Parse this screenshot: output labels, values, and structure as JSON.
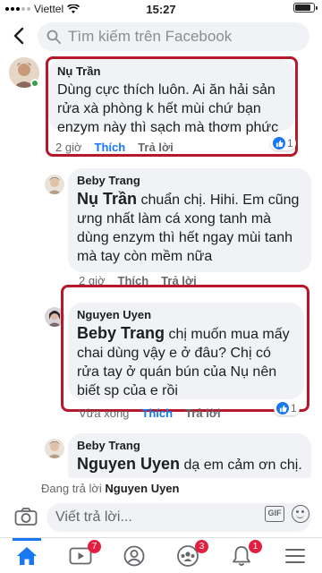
{
  "status_bar": {
    "carrier": "Viettel",
    "time": "15:27",
    "battery_level": 0.85
  },
  "search": {
    "placeholder": "Tìm kiếm trên Facebook"
  },
  "comments": [
    {
      "author": "Nụ Trần",
      "text": "Dùng cực thích luôn. Ai ăn hải sản rửa xà phòng k hết mùi chứ bạn enzym này thì sạch mà thơm phức",
      "time": "2 giờ",
      "like_label": "Thích",
      "reply_label": "Trả lời",
      "reactions": "1"
    },
    {
      "author": "Beby Trang",
      "mention": "Nụ Trần",
      "text": " chuẩn chị. Hihi. Em cũng ưng nhất làm cá xong tanh mà dùng enzym thì hết ngay mùi tanh mà tay còn mềm nữa",
      "time": "2 giờ",
      "like_label": "Thích",
      "reply_label": "Trả lời"
    },
    {
      "author": "Nguyen Uyen",
      "mention": "Beby Trang",
      "text": " chị muốn mua mấy chai dùng vậy e ở đâu? Chị có rửa tay ở quán bún của Nụ nên biết sp của e rồi",
      "time": "Vừa xong",
      "like_label": "Thích",
      "reply_label": "Trả lời",
      "reactions": "1"
    },
    {
      "author": "Beby Trang",
      "mention": "Nguyen Uyen",
      "text": " dạ em cảm ơn chị."
    }
  ],
  "replying_to": {
    "prefix": "Đang trả lời",
    "name": "Nguyen Uyen"
  },
  "composer": {
    "placeholder": "Viết trả lời...",
    "gif_label": "GIF"
  },
  "bottom_nav": {
    "watch_badge": "7",
    "groups_badge": "3",
    "notifications_badge": "1"
  },
  "colors": {
    "accent": "#1877f2",
    "highlight": "#b7192c",
    "badge": "#e41e3f"
  }
}
